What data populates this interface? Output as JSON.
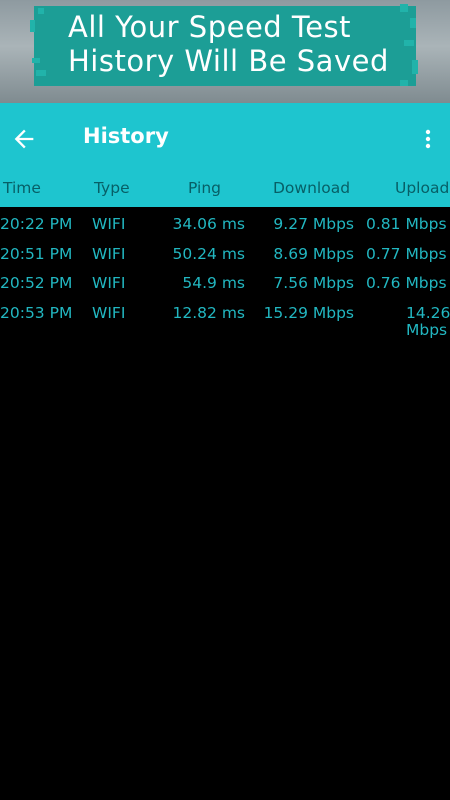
{
  "banner": {
    "line1": "All Your Speed Test",
    "line2": "History Will Be Saved"
  },
  "appbar": {
    "title": "History",
    "back_icon": "arrow-back-icon",
    "menu_icon": "more-vert-icon"
  },
  "colors": {
    "accent": "#1ec5cf",
    "banner_teal": "#1c9e96",
    "text_cyan": "#22b7c1",
    "header_text": "#075f66",
    "background": "#000000"
  },
  "table": {
    "headers": [
      "Time",
      "Type",
      "Ping",
      "Download",
      "Upload"
    ],
    "rows": [
      {
        "time": "20:22 PM",
        "type": "WIFI",
        "ping": "34.06 ms",
        "download": "9.27 Mbps",
        "upload": "0.81 Mbps"
      },
      {
        "time": "20:51 PM",
        "type": "WIFI",
        "ping": "50.24 ms",
        "download": "8.69 Mbps",
        "upload": "0.77 Mbps"
      },
      {
        "time": "20:52 PM",
        "type": "WIFI",
        "ping": "54.9 ms",
        "download": "7.56 Mbps",
        "upload": "0.76 Mbps"
      },
      {
        "time": "20:53 PM",
        "type": "WIFI",
        "ping": "12.82 ms",
        "download": "15.29 Mbps",
        "upload_line1": "14.26",
        "upload_line2": "Mbps"
      }
    ]
  }
}
